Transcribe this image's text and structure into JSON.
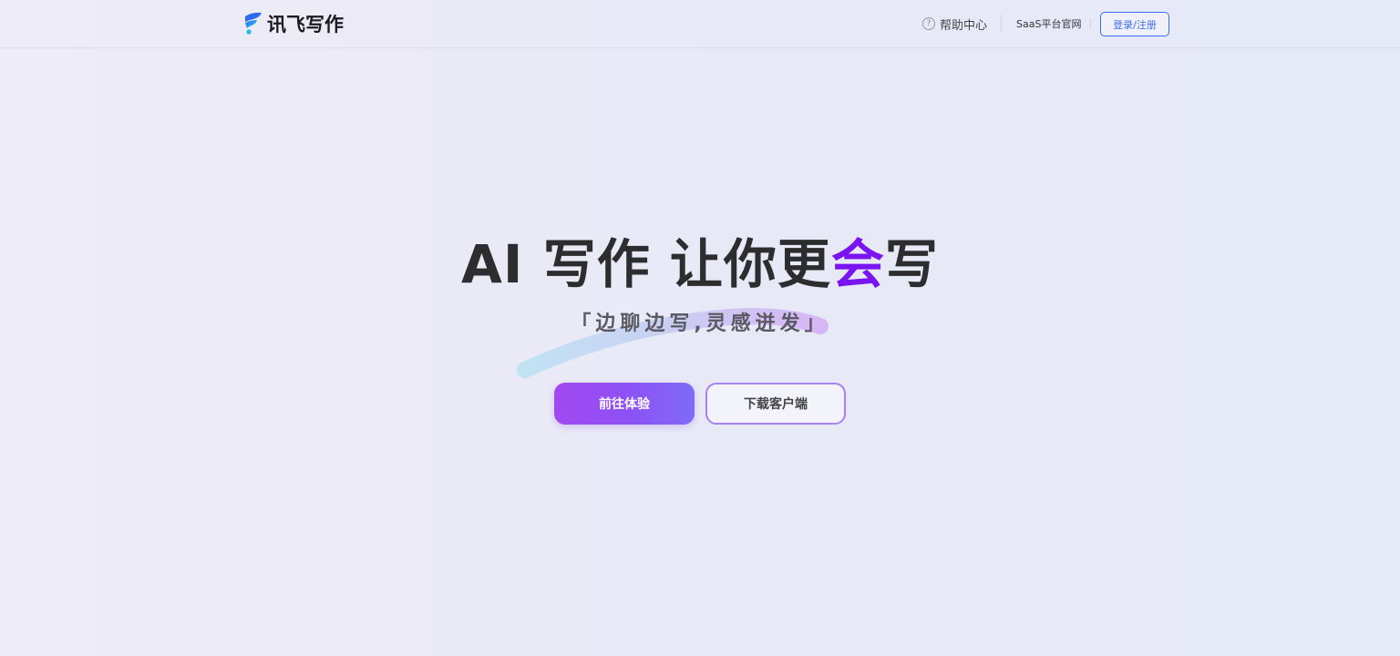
{
  "header": {
    "logo_text": "讯飞写作",
    "help_label": "帮助中心",
    "saas_label": "SaaS平台官网",
    "login_label": "登录/注册"
  },
  "hero": {
    "title_prefix": "AI 写作 让你更",
    "title_accent": "会",
    "title_suffix": "写",
    "subtitle": "「边聊边写,灵感迸发」",
    "primary_button": "前往体验",
    "secondary_button": "下载客户端"
  },
  "colors": {
    "accent": "#7a14f0",
    "link_blue": "#3d6cf0"
  },
  "icons": {
    "help": "question-circle-icon",
    "logo": "iflytek-logo-icon"
  }
}
